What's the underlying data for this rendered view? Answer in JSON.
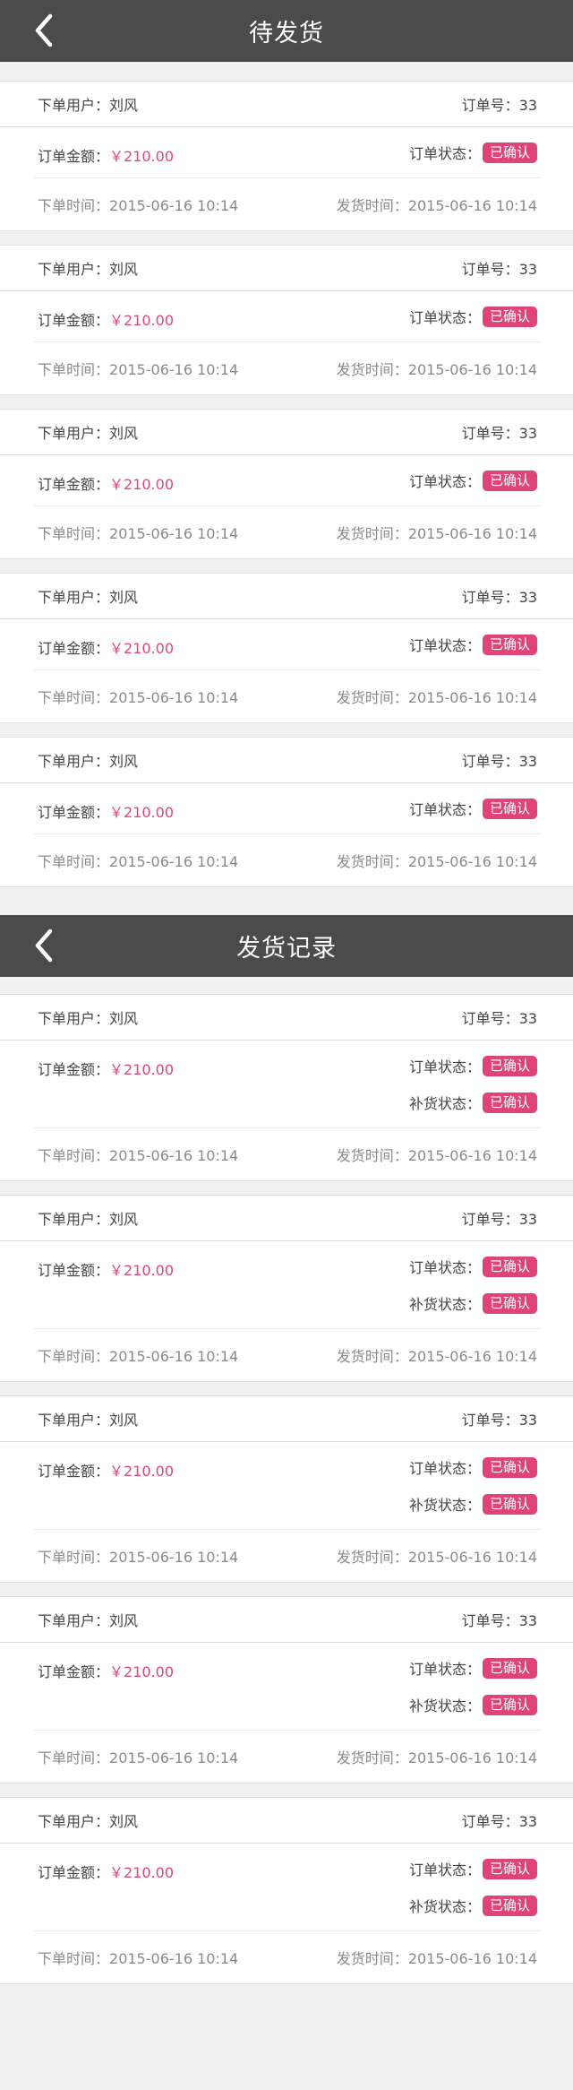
{
  "pending": {
    "title": "待发货",
    "orders": [
      {
        "user_label": "下单用户：",
        "user": "刘风",
        "order_no_label": "订单号：",
        "order_no": "33",
        "amount_label": "订单金额：",
        "amount": "￥210.00",
        "status_label": "订单状态：",
        "status": "已确认",
        "order_time_label": "下单时间：",
        "order_time": "2015-06-16 10:14",
        "ship_time_label": "发货时间：",
        "ship_time": "2015-06-16 10:14"
      },
      {
        "user_label": "下单用户：",
        "user": "刘风",
        "order_no_label": "订单号：",
        "order_no": "33",
        "amount_label": "订单金额：",
        "amount": "￥210.00",
        "status_label": "订单状态：",
        "status": "已确认",
        "order_time_label": "下单时间：",
        "order_time": "2015-06-16 10:14",
        "ship_time_label": "发货时间：",
        "ship_time": "2015-06-16 10:14"
      },
      {
        "user_label": "下单用户：",
        "user": "刘风",
        "order_no_label": "订单号：",
        "order_no": "33",
        "amount_label": "订单金额：",
        "amount": "￥210.00",
        "status_label": "订单状态：",
        "status": "已确认",
        "order_time_label": "下单时间：",
        "order_time": "2015-06-16 10:14",
        "ship_time_label": "发货时间：",
        "ship_time": "2015-06-16 10:14"
      },
      {
        "user_label": "下单用户：",
        "user": "刘风",
        "order_no_label": "订单号：",
        "order_no": "33",
        "amount_label": "订单金额：",
        "amount": "￥210.00",
        "status_label": "订单状态：",
        "status": "已确认",
        "order_time_label": "下单时间：",
        "order_time": "2015-06-16 10:14",
        "ship_time_label": "发货时间：",
        "ship_time": "2015-06-16 10:14"
      },
      {
        "user_label": "下单用户：",
        "user": "刘风",
        "order_no_label": "订单号：",
        "order_no": "33",
        "amount_label": "订单金额：",
        "amount": "￥210.00",
        "status_label": "订单状态：",
        "status": "已确认",
        "order_time_label": "下单时间：",
        "order_time": "2015-06-16 10:14",
        "ship_time_label": "发货时间：",
        "ship_time": "2015-06-16 10:14"
      }
    ]
  },
  "records": {
    "title": "发货记录",
    "orders": [
      {
        "user_label": "下单用户：",
        "user": "刘风",
        "order_no_label": "订单号：",
        "order_no": "33",
        "amount_label": "订单金额：",
        "amount": "￥210.00",
        "status_label": "订单状态：",
        "status": "已确认",
        "restock_label": "补货状态：",
        "restock": "已确认",
        "order_time_label": "下单时间：",
        "order_time": "2015-06-16 10:14",
        "ship_time_label": "发货时间：",
        "ship_time": "2015-06-16 10:14"
      },
      {
        "user_label": "下单用户：",
        "user": "刘风",
        "order_no_label": "订单号：",
        "order_no": "33",
        "amount_label": "订单金额：",
        "amount": "￥210.00",
        "status_label": "订单状态：",
        "status": "已确认",
        "restock_label": "补货状态：",
        "restock": "已确认",
        "order_time_label": "下单时间：",
        "order_time": "2015-06-16 10:14",
        "ship_time_label": "发货时间：",
        "ship_time": "2015-06-16 10:14"
      },
      {
        "user_label": "下单用户：",
        "user": "刘风",
        "order_no_label": "订单号：",
        "order_no": "33",
        "amount_label": "订单金额：",
        "amount": "￥210.00",
        "status_label": "订单状态：",
        "status": "已确认",
        "restock_label": "补货状态：",
        "restock": "已确认",
        "order_time_label": "下单时间：",
        "order_time": "2015-06-16 10:14",
        "ship_time_label": "发货时间：",
        "ship_time": "2015-06-16 10:14"
      },
      {
        "user_label": "下单用户：",
        "user": "刘风",
        "order_no_label": "订单号：",
        "order_no": "33",
        "amount_label": "订单金额：",
        "amount": "￥210.00",
        "status_label": "订单状态：",
        "status": "已确认",
        "restock_label": "补货状态：",
        "restock": "已确认",
        "order_time_label": "下单时间：",
        "order_time": "2015-06-16 10:14",
        "ship_time_label": "发货时间：",
        "ship_time": "2015-06-16 10:14"
      },
      {
        "user_label": "下单用户：",
        "user": "刘风",
        "order_no_label": "订单号：",
        "order_no": "33",
        "amount_label": "订单金额：",
        "amount": "￥210.00",
        "status_label": "订单状态：",
        "status": "已确认",
        "restock_label": "补货状态：",
        "restock": "已确认",
        "order_time_label": "下单时间：",
        "order_time": "2015-06-16 10:14",
        "ship_time_label": "发货时间：",
        "ship_time": "2015-06-16 10:14"
      }
    ]
  },
  "colors": {
    "header_bg": "#4b4b4b",
    "accent": "#e0437a",
    "amount": "#e0487d"
  },
  "icons": {
    "back": "chevron-left-icon"
  }
}
